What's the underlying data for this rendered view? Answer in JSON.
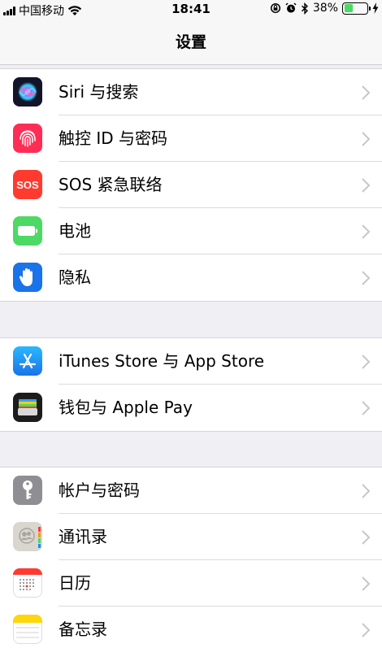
{
  "status_bar": {
    "carrier": "中国移动",
    "time": "18:41",
    "battery_percent": "38%",
    "battery_level": 0.38
  },
  "nav": {
    "title": "设置"
  },
  "groups": [
    {
      "items": [
        {
          "label": "Siri 与搜索",
          "icon": "siri-icon"
        },
        {
          "label": "触控 ID 与密码",
          "icon": "fingerprint-icon"
        },
        {
          "label": "SOS 紧急联络",
          "icon": "sos-icon",
          "icon_text": "SOS"
        },
        {
          "label": "电池",
          "icon": "battery-icon"
        },
        {
          "label": "隐私",
          "icon": "hand-icon"
        }
      ]
    },
    {
      "items": [
        {
          "label": "iTunes Store 与 App Store",
          "icon": "app-store-icon"
        },
        {
          "label": "钱包与 Apple Pay",
          "icon": "wallet-icon"
        }
      ]
    },
    {
      "items": [
        {
          "label": "帐户与密码",
          "icon": "key-icon"
        },
        {
          "label": "通讯录",
          "icon": "contacts-icon"
        },
        {
          "label": "日历",
          "icon": "calendar-icon"
        },
        {
          "label": "备忘录",
          "icon": "notes-icon"
        }
      ]
    }
  ],
  "colors": {
    "siri": "#1a1a2e",
    "touch_id": "#ff2d55",
    "sos": "#ff3b30",
    "battery": "#4cd964",
    "privacy": "#1a73e8",
    "app_store": "#1a8cff",
    "wallet": "#1c1c1c",
    "key": "#8e8e93",
    "contacts": "#d9d6cf",
    "calendar": "#ffffff",
    "notes": "#ffd60a"
  }
}
